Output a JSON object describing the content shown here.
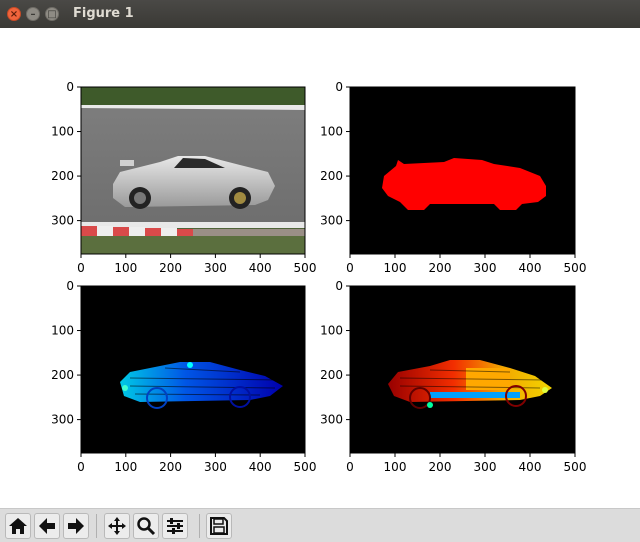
{
  "window": {
    "title": "Figure 1"
  },
  "toolbar": {
    "buttons": [
      {
        "name": "home-button",
        "icon": "home-icon"
      },
      {
        "name": "back-button",
        "icon": "left-arrow-icon"
      },
      {
        "name": "forward-button",
        "icon": "right-arrow-icon"
      },
      {
        "name": "pan-button",
        "icon": "move-icon"
      },
      {
        "name": "zoom-button",
        "icon": "magnifier-icon"
      },
      {
        "name": "configure-subplots-button",
        "icon": "sliders-icon"
      },
      {
        "name": "save-button",
        "icon": "floppy-disk-icon"
      }
    ]
  },
  "subplots": [
    {
      "name": "subplot-original-image",
      "content": "photo of silver sports car on race track",
      "x_ticks": [
        "0",
        "100",
        "200",
        "300",
        "400",
        "500"
      ],
      "y_ticks": [
        "0",
        "100",
        "200",
        "300"
      ]
    },
    {
      "name": "subplot-red-mask",
      "content": "red car silhouette on black",
      "mask_color": "#ff0000",
      "x_ticks": [
        "0",
        "100",
        "200",
        "300",
        "400",
        "500"
      ],
      "y_ticks": [
        "0",
        "100",
        "200",
        "300"
      ]
    },
    {
      "name": "subplot-blue-cyan-edges",
      "content": "jet colormap edge map (blue/cyan) on black",
      "x_ticks": [
        "0",
        "100",
        "200",
        "300",
        "400",
        "500"
      ],
      "y_ticks": [
        "0",
        "100",
        "200",
        "300"
      ]
    },
    {
      "name": "subplot-red-yellow-edges",
      "content": "jet colormap edge map (red/yellow) on black",
      "x_ticks": [
        "0",
        "100",
        "200",
        "300",
        "400",
        "500"
      ],
      "y_ticks": [
        "0",
        "100",
        "200",
        "300"
      ]
    }
  ],
  "colors": {
    "titlebar": "#3c3b37",
    "close": "#f0643c",
    "toolbar": "#dcdcdc"
  }
}
